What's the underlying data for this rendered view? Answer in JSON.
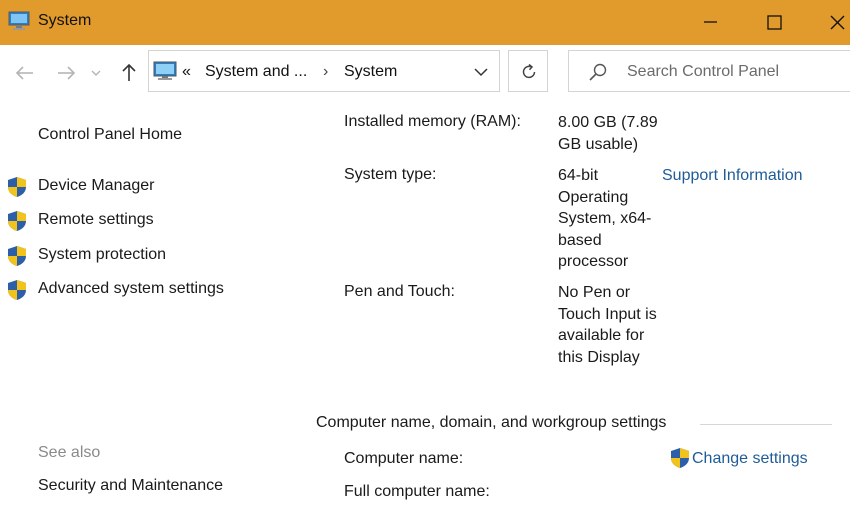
{
  "window": {
    "title": "System",
    "controls": [
      "minimize-icon",
      "maximize-icon",
      "close-icon"
    ]
  },
  "nav": {
    "back_icon": "arrow-left-icon",
    "forward_icon": "arrow-right-icon",
    "recent_icon": "chevron-down-icon",
    "up_icon": "arrow-up-icon",
    "address": {
      "overflow": "«",
      "crumb1": "System and ...",
      "separator": "›",
      "crumb2": "System"
    },
    "refresh_icon": "refresh-icon",
    "search_placeholder": "Search Control Panel"
  },
  "sidebar": {
    "home": "Control Panel Home",
    "items": [
      {
        "label": "Device Manager",
        "icon": "shield-icon"
      },
      {
        "label": "Remote settings",
        "icon": "shield-icon"
      },
      {
        "label": "System protection",
        "icon": "shield-icon"
      },
      {
        "label": "Advanced system settings",
        "icon": "shield-icon"
      }
    ],
    "see_also": "See also",
    "see_also_items": [
      "Security and Maintenance"
    ]
  },
  "system_info": {
    "ram_label": "Installed memory (RAM):",
    "ram_value": "8.00 GB (7.89 GB usable)",
    "type_label": "System type:",
    "type_value": "64-bit Operating System, x64-based processor",
    "support_link": "Support Information",
    "pen_label": "Pen and Touch:",
    "pen_value": "No Pen or Touch Input is available for this Display"
  },
  "computer_name": {
    "section_title": "Computer name, domain, and workgroup settings",
    "name_label": "Computer name:",
    "fullname_label": "Full computer name:",
    "change_link": "Change settings"
  },
  "colors": {
    "titlebar": "#e19a2c",
    "link": "#1f5c97"
  }
}
